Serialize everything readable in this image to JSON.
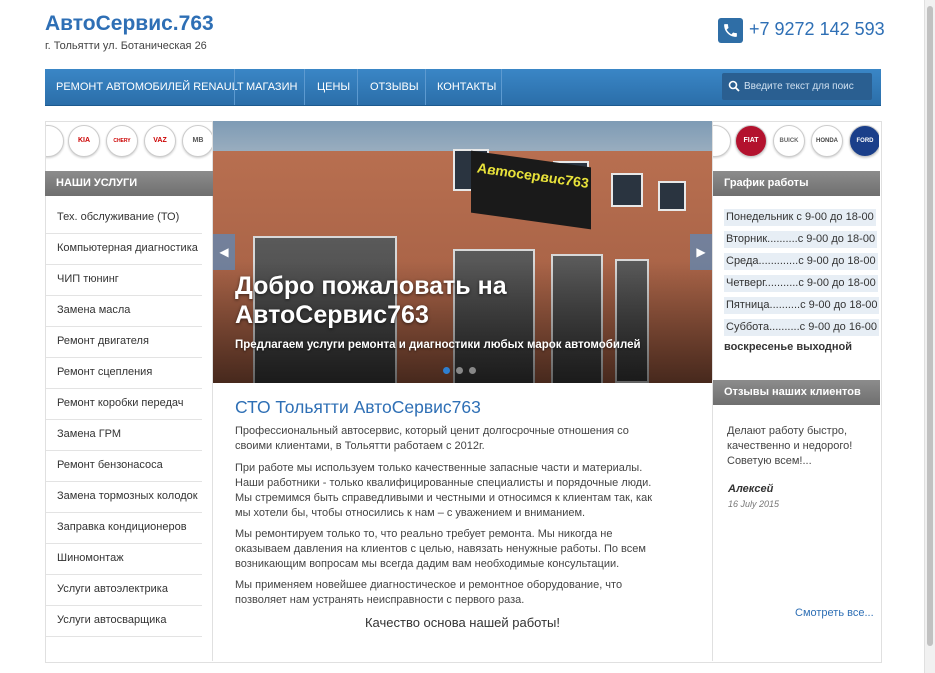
{
  "header": {
    "site_title": "АвтоСервис.763",
    "address": "г. Тольятти ул. Ботаническая 26",
    "phone": "+7 9272 142 593"
  },
  "nav": {
    "items": [
      "Ремонт автомобилей Renault",
      "Магазин",
      "Цены",
      "Отзывы",
      "Контакты"
    ],
    "search_placeholder": "Введите текст для поис"
  },
  "brands_left": [
    "KIA",
    "CHERY",
    "VAZ",
    "MB"
  ],
  "brands_right": [
    "FIAT",
    "BUICK",
    "HONDA",
    "FORD"
  ],
  "services": {
    "title": "НАШИ УСЛУГИ",
    "items": [
      "Тех. обслуживание (ТО)",
      "Компьютерная диагностика",
      "ЧИП тюнинг",
      "Замена масла",
      "Ремонт двигателя",
      "Ремонт сцепления",
      "Ремонт коробки передач",
      "Замена ГРМ",
      "Ремонт бензонасоса",
      "Замена тормозных колодок",
      "Заправка кондиционеров",
      "Шиномонтаж",
      "Услуги автоэлектрика",
      "Услуги автосварщика"
    ]
  },
  "slider": {
    "sign_text": "Автосервис763",
    "title": "Добро пожаловать на АвтоСервис763",
    "subtitle": "Предлагаем услуги ремонта и диагностики любых марок автомобилей",
    "prev_icon": "◀",
    "next_icon": "▶",
    "active_dot": 0,
    "dot_count": 3
  },
  "main": {
    "title": "СТО Тольятти АвтоСервис763",
    "paragraphs": [
      "Профессиональный автосервис, который ценит долгосрочные отношения со своими клиентами, в Тольятти работаем с 2012г.",
      "При работе мы используем только качественные запасные части и материалы. Наши работники - только квалифицированные специалисты и порядочные люди. Мы стремимся быть справедливыми и честными и относимся к клиентам так, как мы хотели бы, чтобы относились к нам – с уважением и вниманием.",
      "Мы ремонтируем только то, что реально требует ремонта. Мы никогда не оказываем давления на клиентов с целью, навязать ненужные работы. По всем возникающим вопросам мы всегда дадим вам необходимые консультации.",
      "Мы применяем новейшее диагностическое и ремонтное оборудование, что позволяет нам устранять неисправности с первого раза."
    ],
    "motto": "Качество основа нашей работы!"
  },
  "schedule": {
    "title": "График работы",
    "rows": [
      "Понедельник с 9-00 до 18-00",
      "Вторник..........с 9-00 до 18-00",
      "Среда.............с 9-00 до 18-00",
      "Четверг...........с 9-00 до 18-00",
      "Пятница..........с 9-00 до 18-00",
      "Суббота..........с 9-00 до 16-00"
    ],
    "day_off": "воскресенье выходной"
  },
  "reviews": {
    "title": "Отзывы наших клиентов",
    "text": "Делают работу быстро, качественно и недорого! Советую всем!...",
    "author": "Алексей",
    "date": "16 July 2015",
    "see_all": "Смотреть все..."
  },
  "colors": {
    "accent": "#2e6fb5",
    "nav": "#3a86c6",
    "sidebar_header": "#7d7d7d"
  }
}
